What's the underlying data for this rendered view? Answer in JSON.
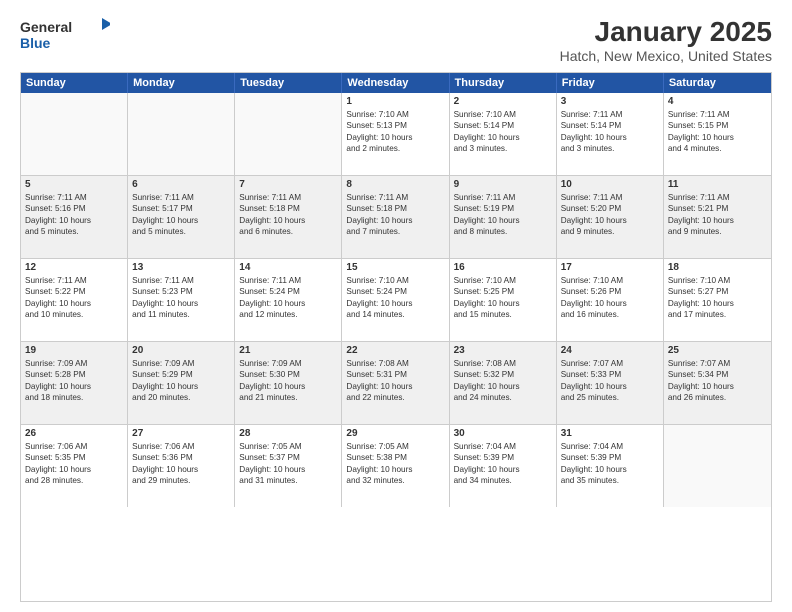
{
  "header": {
    "logo": {
      "general": "General",
      "blue": "Blue"
    },
    "title": "January 2025",
    "subtitle": "Hatch, New Mexico, United States"
  },
  "calendar": {
    "days_of_week": [
      "Sunday",
      "Monday",
      "Tuesday",
      "Wednesday",
      "Thursday",
      "Friday",
      "Saturday"
    ],
    "weeks": [
      [
        {
          "num": "",
          "lines": []
        },
        {
          "num": "",
          "lines": []
        },
        {
          "num": "",
          "lines": []
        },
        {
          "num": "1",
          "lines": [
            "Sunrise: 7:10 AM",
            "Sunset: 5:13 PM",
            "Daylight: 10 hours",
            "and 2 minutes."
          ]
        },
        {
          "num": "2",
          "lines": [
            "Sunrise: 7:10 AM",
            "Sunset: 5:14 PM",
            "Daylight: 10 hours",
            "and 3 minutes."
          ]
        },
        {
          "num": "3",
          "lines": [
            "Sunrise: 7:11 AM",
            "Sunset: 5:14 PM",
            "Daylight: 10 hours",
            "and 3 minutes."
          ]
        },
        {
          "num": "4",
          "lines": [
            "Sunrise: 7:11 AM",
            "Sunset: 5:15 PM",
            "Daylight: 10 hours",
            "and 4 minutes."
          ]
        }
      ],
      [
        {
          "num": "5",
          "lines": [
            "Sunrise: 7:11 AM",
            "Sunset: 5:16 PM",
            "Daylight: 10 hours",
            "and 5 minutes."
          ]
        },
        {
          "num": "6",
          "lines": [
            "Sunrise: 7:11 AM",
            "Sunset: 5:17 PM",
            "Daylight: 10 hours",
            "and 5 minutes."
          ]
        },
        {
          "num": "7",
          "lines": [
            "Sunrise: 7:11 AM",
            "Sunset: 5:18 PM",
            "Daylight: 10 hours",
            "and 6 minutes."
          ]
        },
        {
          "num": "8",
          "lines": [
            "Sunrise: 7:11 AM",
            "Sunset: 5:18 PM",
            "Daylight: 10 hours",
            "and 7 minutes."
          ]
        },
        {
          "num": "9",
          "lines": [
            "Sunrise: 7:11 AM",
            "Sunset: 5:19 PM",
            "Daylight: 10 hours",
            "and 8 minutes."
          ]
        },
        {
          "num": "10",
          "lines": [
            "Sunrise: 7:11 AM",
            "Sunset: 5:20 PM",
            "Daylight: 10 hours",
            "and 9 minutes."
          ]
        },
        {
          "num": "11",
          "lines": [
            "Sunrise: 7:11 AM",
            "Sunset: 5:21 PM",
            "Daylight: 10 hours",
            "and 9 minutes."
          ]
        }
      ],
      [
        {
          "num": "12",
          "lines": [
            "Sunrise: 7:11 AM",
            "Sunset: 5:22 PM",
            "Daylight: 10 hours",
            "and 10 minutes."
          ]
        },
        {
          "num": "13",
          "lines": [
            "Sunrise: 7:11 AM",
            "Sunset: 5:23 PM",
            "Daylight: 10 hours",
            "and 11 minutes."
          ]
        },
        {
          "num": "14",
          "lines": [
            "Sunrise: 7:11 AM",
            "Sunset: 5:24 PM",
            "Daylight: 10 hours",
            "and 12 minutes."
          ]
        },
        {
          "num": "15",
          "lines": [
            "Sunrise: 7:10 AM",
            "Sunset: 5:24 PM",
            "Daylight: 10 hours",
            "and 14 minutes."
          ]
        },
        {
          "num": "16",
          "lines": [
            "Sunrise: 7:10 AM",
            "Sunset: 5:25 PM",
            "Daylight: 10 hours",
            "and 15 minutes."
          ]
        },
        {
          "num": "17",
          "lines": [
            "Sunrise: 7:10 AM",
            "Sunset: 5:26 PM",
            "Daylight: 10 hours",
            "and 16 minutes."
          ]
        },
        {
          "num": "18",
          "lines": [
            "Sunrise: 7:10 AM",
            "Sunset: 5:27 PM",
            "Daylight: 10 hours",
            "and 17 minutes."
          ]
        }
      ],
      [
        {
          "num": "19",
          "lines": [
            "Sunrise: 7:09 AM",
            "Sunset: 5:28 PM",
            "Daylight: 10 hours",
            "and 18 minutes."
          ]
        },
        {
          "num": "20",
          "lines": [
            "Sunrise: 7:09 AM",
            "Sunset: 5:29 PM",
            "Daylight: 10 hours",
            "and 20 minutes."
          ]
        },
        {
          "num": "21",
          "lines": [
            "Sunrise: 7:09 AM",
            "Sunset: 5:30 PM",
            "Daylight: 10 hours",
            "and 21 minutes."
          ]
        },
        {
          "num": "22",
          "lines": [
            "Sunrise: 7:08 AM",
            "Sunset: 5:31 PM",
            "Daylight: 10 hours",
            "and 22 minutes."
          ]
        },
        {
          "num": "23",
          "lines": [
            "Sunrise: 7:08 AM",
            "Sunset: 5:32 PM",
            "Daylight: 10 hours",
            "and 24 minutes."
          ]
        },
        {
          "num": "24",
          "lines": [
            "Sunrise: 7:07 AM",
            "Sunset: 5:33 PM",
            "Daylight: 10 hours",
            "and 25 minutes."
          ]
        },
        {
          "num": "25",
          "lines": [
            "Sunrise: 7:07 AM",
            "Sunset: 5:34 PM",
            "Daylight: 10 hours",
            "and 26 minutes."
          ]
        }
      ],
      [
        {
          "num": "26",
          "lines": [
            "Sunrise: 7:06 AM",
            "Sunset: 5:35 PM",
            "Daylight: 10 hours",
            "and 28 minutes."
          ]
        },
        {
          "num": "27",
          "lines": [
            "Sunrise: 7:06 AM",
            "Sunset: 5:36 PM",
            "Daylight: 10 hours",
            "and 29 minutes."
          ]
        },
        {
          "num": "28",
          "lines": [
            "Sunrise: 7:05 AM",
            "Sunset: 5:37 PM",
            "Daylight: 10 hours",
            "and 31 minutes."
          ]
        },
        {
          "num": "29",
          "lines": [
            "Sunrise: 7:05 AM",
            "Sunset: 5:38 PM",
            "Daylight: 10 hours",
            "and 32 minutes."
          ]
        },
        {
          "num": "30",
          "lines": [
            "Sunrise: 7:04 AM",
            "Sunset: 5:39 PM",
            "Daylight: 10 hours",
            "and 34 minutes."
          ]
        },
        {
          "num": "31",
          "lines": [
            "Sunrise: 7:04 AM",
            "Sunset: 5:39 PM",
            "Daylight: 10 hours",
            "and 35 minutes."
          ]
        },
        {
          "num": "",
          "lines": []
        }
      ]
    ]
  }
}
